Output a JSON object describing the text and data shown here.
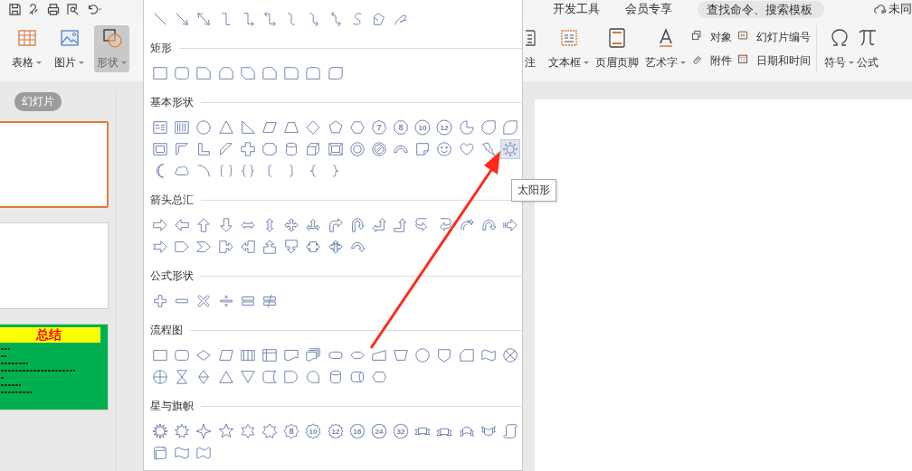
{
  "menu_tabs": [
    {
      "label": "开发工具",
      "selected": false
    },
    {
      "label": "会员专享",
      "selected": false
    }
  ],
  "search": {
    "placeholder": "查找命令、搜索模板"
  },
  "sync_status": "未同",
  "ribbon": {
    "left": [
      {
        "kind": "table",
        "label": "表格",
        "dropdown": true,
        "selected": false
      },
      {
        "kind": "picture",
        "label": "图片",
        "dropdown": true,
        "selected": false
      },
      {
        "kind": "shape",
        "label": "形状",
        "dropdown": true,
        "selected": true
      }
    ],
    "right": [
      {
        "kind": "note",
        "label": "注",
        "dropdown": false
      },
      {
        "kind": "textbox",
        "label": "文本框",
        "dropdown": true
      },
      {
        "kind": "header-footer",
        "label": "页眉页脚",
        "dropdown": false
      },
      {
        "kind": "wordart",
        "label": "艺术字",
        "dropdown": true
      }
    ],
    "small_columns": [
      [
        {
          "kind": "object",
          "label": "对象"
        },
        {
          "kind": "attachment",
          "label": "附件"
        }
      ],
      [
        {
          "kind": "slide-number",
          "label": "幻灯片编号"
        },
        {
          "kind": "datetime",
          "label": "日期和时间"
        }
      ]
    ],
    "far": [
      {
        "kind": "symbol",
        "label": "符号",
        "dropdown": true
      },
      {
        "kind": "formula",
        "label": "公式",
        "dropdown": false
      }
    ]
  },
  "panel_tab": {
    "label": "幻灯片",
    "selected": true
  },
  "slides": [
    {
      "kind": "blank",
      "selected": true
    },
    {
      "kind": "blank",
      "selected": false
    },
    {
      "kind": "summary",
      "selected": false,
      "title": "总结"
    }
  ],
  "gallery": [
    {
      "shapes": [
        {
          "kind": "line",
          "selected": false
        },
        {
          "kind": "arrow-line",
          "selected": false
        },
        {
          "kind": "double-arrow-line",
          "selected": false
        },
        {
          "kind": "elbow",
          "selected": false
        },
        {
          "kind": "elbow-arrow",
          "selected": false
        },
        {
          "kind": "elbow-double-arrow",
          "selected": false
        },
        {
          "kind": "curve",
          "selected": false
        },
        {
          "kind": "curve-arrow",
          "selected": false
        },
        {
          "kind": "curve-double-arrow",
          "selected": false
        },
        {
          "kind": "s-curve",
          "selected": false
        },
        {
          "kind": "freeform",
          "selected": false
        },
        {
          "kind": "scribble",
          "selected": false
        }
      ]
    },
    {
      "title": "矩形",
      "shapes": [
        {
          "kind": "rect",
          "selected": false
        },
        {
          "kind": "round-rect",
          "selected": false
        },
        {
          "kind": "snip-corner",
          "selected": false
        },
        {
          "kind": "snip-top",
          "selected": false
        },
        {
          "kind": "snip-diagonal",
          "selected": false
        },
        {
          "kind": "snip-round",
          "selected": false
        },
        {
          "kind": "round-corner",
          "selected": false
        },
        {
          "kind": "round-top",
          "selected": false
        },
        {
          "kind": "round-diagonal",
          "selected": false
        }
      ]
    },
    {
      "title": "基本形状",
      "shapes": [
        {
          "kind": "text-box",
          "selected": false
        },
        {
          "kind": "vertical-text-box",
          "selected": false
        },
        {
          "kind": "circle",
          "selected": false
        },
        {
          "kind": "triangle",
          "selected": false
        },
        {
          "kind": "right-triangle",
          "selected": false
        },
        {
          "kind": "parallelogram",
          "selected": false
        },
        {
          "kind": "trapezoid",
          "selected": false
        },
        {
          "kind": "diamond",
          "selected": false
        },
        {
          "kind": "pentagon",
          "selected": false
        },
        {
          "kind": "hexagon",
          "selected": false
        },
        {
          "kind": "heptagon",
          "selected": false,
          "label": "7"
        },
        {
          "kind": "octagon",
          "selected": false,
          "label": "8"
        },
        {
          "kind": "decagon",
          "selected": false,
          "label": "10"
        },
        {
          "kind": "dodecagon",
          "selected": false,
          "label": "12"
        },
        {
          "kind": "pie",
          "selected": false
        },
        {
          "kind": "teardrop",
          "selected": false
        },
        {
          "kind": "leaf",
          "selected": false
        },
        {
          "kind": "frame",
          "selected": false
        },
        {
          "kind": "half-frame",
          "selected": false
        },
        {
          "kind": "l-shape",
          "selected": false
        },
        {
          "kind": "diagonal-stripe",
          "selected": false
        },
        {
          "kind": "cross",
          "selected": false
        },
        {
          "kind": "plaque",
          "selected": false
        },
        {
          "kind": "can",
          "selected": false
        },
        {
          "kind": "cube",
          "selected": false
        },
        {
          "kind": "bevel",
          "selected": false
        },
        {
          "kind": "donut",
          "selected": false
        },
        {
          "kind": "no-symbol",
          "selected": false
        },
        {
          "kind": "block-arc",
          "selected": false
        },
        {
          "kind": "folded-corner",
          "selected": false
        },
        {
          "kind": "smiley",
          "selected": false
        },
        {
          "kind": "heart",
          "selected": false
        },
        {
          "kind": "lightning",
          "selected": false
        },
        {
          "kind": "sun",
          "selected": true
        },
        {
          "kind": "moon",
          "selected": false
        },
        {
          "kind": "cloud",
          "selected": false
        },
        {
          "kind": "arc",
          "selected": false
        },
        {
          "kind": "bracket-pair",
          "selected": false
        },
        {
          "kind": "brace-pair",
          "selected": false
        },
        {
          "kind": "left-bracket",
          "selected": false
        },
        {
          "kind": "right-bracket",
          "selected": false
        },
        {
          "kind": "left-brace",
          "selected": false
        },
        {
          "kind": "right-brace",
          "selected": false
        }
      ]
    },
    {
      "title": "箭头总汇",
      "shapes": [
        {
          "kind": "right-arrow",
          "selected": false
        },
        {
          "kind": "left-arrow",
          "selected": false
        },
        {
          "kind": "up-arrow",
          "selected": false
        },
        {
          "kind": "down-arrow",
          "selected": false
        },
        {
          "kind": "left-right-arrow",
          "selected": false
        },
        {
          "kind": "up-down-arrow",
          "selected": false
        },
        {
          "kind": "quad-arrow",
          "selected": false
        },
        {
          "kind": "left-right-up-arrow",
          "selected": false
        },
        {
          "kind": "bent-arrow",
          "selected": false
        },
        {
          "kind": "u-turn-arrow",
          "selected": false
        },
        {
          "kind": "left-up-arrow",
          "selected": false
        },
        {
          "kind": "bent-up-arrow",
          "selected": false
        },
        {
          "kind": "curved-right-arrow",
          "selected": false
        },
        {
          "kind": "curved-left-arrow",
          "selected": false
        },
        {
          "kind": "curved-up-arrow",
          "selected": false
        },
        {
          "kind": "curved-down-arrow",
          "selected": false
        },
        {
          "kind": "striped-right-arrow",
          "selected": false
        },
        {
          "kind": "notched-right-arrow",
          "selected": false
        },
        {
          "kind": "pentagon-arrow",
          "selected": false
        },
        {
          "kind": "chevron",
          "selected": false
        },
        {
          "kind": "right-arrow-callout",
          "selected": false
        },
        {
          "kind": "left-arrow-callout",
          "selected": false
        },
        {
          "kind": "up-arrow-callout",
          "selected": false
        },
        {
          "kind": "down-arrow-callout",
          "selected": false
        },
        {
          "kind": "left-right-arrow-callout",
          "selected": false
        },
        {
          "kind": "quad-arrow-callout",
          "selected": false
        },
        {
          "kind": "circular-arrow",
          "selected": false
        }
      ]
    },
    {
      "title": "公式形状",
      "shapes": [
        {
          "kind": "plus",
          "selected": false
        },
        {
          "kind": "minus",
          "selected": false
        },
        {
          "kind": "multiply",
          "selected": false
        },
        {
          "kind": "divide",
          "selected": false
        },
        {
          "kind": "equal",
          "selected": false
        },
        {
          "kind": "not-equal",
          "selected": false
        }
      ]
    },
    {
      "title": "流程图",
      "shapes": [
        {
          "kind": "process",
          "selected": false
        },
        {
          "kind": "alternate-process",
          "selected": false
        },
        {
          "kind": "decision",
          "selected": false
        },
        {
          "kind": "data",
          "selected": false
        },
        {
          "kind": "predefined-process",
          "selected": false
        },
        {
          "kind": "internal-storage",
          "selected": false
        },
        {
          "kind": "document",
          "selected": false
        },
        {
          "kind": "multidocument",
          "selected": false
        },
        {
          "kind": "terminator",
          "selected": false
        },
        {
          "kind": "preparation",
          "selected": false
        },
        {
          "kind": "manual-input",
          "selected": false
        },
        {
          "kind": "manual-operation",
          "selected": false
        },
        {
          "kind": "connector",
          "selected": false
        },
        {
          "kind": "offpage-connector",
          "selected": false
        },
        {
          "kind": "card",
          "selected": false
        },
        {
          "kind": "punched-tape",
          "selected": false
        },
        {
          "kind": "summing-junction",
          "selected": false
        },
        {
          "kind": "or",
          "selected": false
        },
        {
          "kind": "collate",
          "selected": false
        },
        {
          "kind": "sort",
          "selected": false
        },
        {
          "kind": "extract",
          "selected": false
        },
        {
          "kind": "merge",
          "selected": false
        },
        {
          "kind": "stored-data",
          "selected": false
        },
        {
          "kind": "delay",
          "selected": false
        },
        {
          "kind": "sequential-storage",
          "selected": false
        },
        {
          "kind": "magnetic-disk",
          "selected": false
        },
        {
          "kind": "direct-access-storage",
          "selected": false
        },
        {
          "kind": "display",
          "selected": false
        }
      ]
    },
    {
      "title": "星与旗帜",
      "shapes": [
        {
          "kind": "explosion",
          "selected": false
        },
        {
          "kind": "explosion-small",
          "selected": false
        },
        {
          "kind": "star-four",
          "selected": false
        },
        {
          "kind": "star-five",
          "selected": false
        },
        {
          "kind": "star-six",
          "selected": false
        },
        {
          "kind": "star-seven",
          "selected": false
        },
        {
          "kind": "star-eight",
          "selected": false,
          "label": "8"
        },
        {
          "kind": "star-ten",
          "selected": false,
          "label": "10"
        },
        {
          "kind": "star-twelve",
          "selected": false,
          "label": "12"
        },
        {
          "kind": "star-sixteen",
          "selected": false,
          "label": "16"
        },
        {
          "kind": "star-twenty-four",
          "selected": false,
          "label": "24"
        },
        {
          "kind": "star-thirty-two",
          "selected": false,
          "label": "32"
        },
        {
          "kind": "ribbon-down",
          "selected": false
        },
        {
          "kind": "ribbon-up",
          "selected": false
        },
        {
          "kind": "curved-ribbon-down",
          "selected": false
        },
        {
          "kind": "curved-ribbon-up",
          "selected": false
        },
        {
          "kind": "vertical-scroll",
          "selected": false
        },
        {
          "kind": "horizontal-scroll",
          "selected": false
        },
        {
          "kind": "wave",
          "selected": false
        },
        {
          "kind": "double-wave",
          "selected": false
        }
      ]
    }
  ],
  "tooltip": "太阳形"
}
